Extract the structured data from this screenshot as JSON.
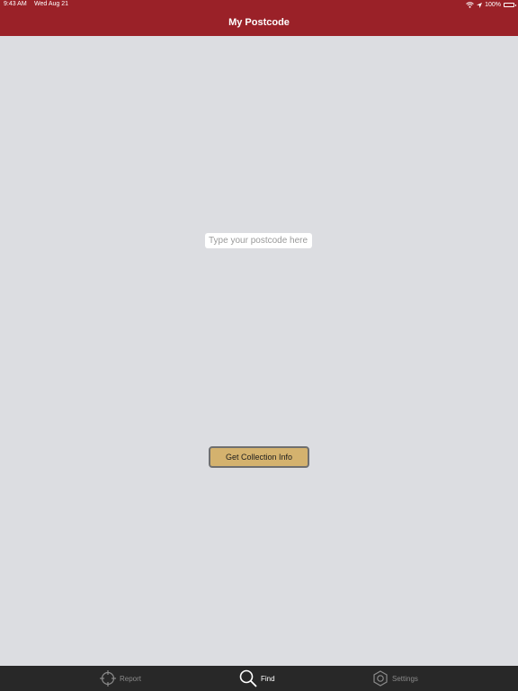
{
  "status_bar": {
    "time": "9:43 AM",
    "date": "Wed Aug 21",
    "battery": "100%"
  },
  "header": {
    "title": "My Postcode",
    "background": "#9a2128"
  },
  "postcode": {
    "value": "",
    "placeholder": "Type your postcode here"
  },
  "actions": {
    "get_collection_info": "Get Collection Info",
    "button_color": "#d4b26e"
  },
  "tabs": [
    {
      "label": "Report",
      "icon": "crosshair-icon",
      "active": false
    },
    {
      "label": "Find",
      "icon": "search-icon",
      "active": true
    },
    {
      "label": "Settings",
      "icon": "gear-icon",
      "active": false
    }
  ]
}
